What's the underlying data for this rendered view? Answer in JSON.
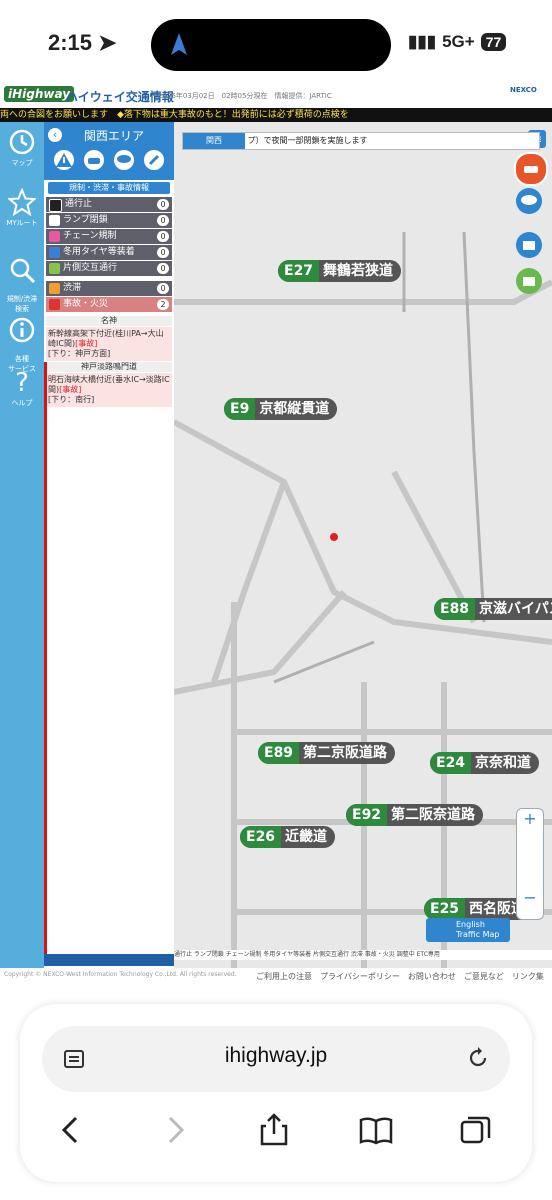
{
  "status_bar": {
    "time": "2:15",
    "network": "5G+",
    "battery": "77"
  },
  "site_header": {
    "logo": "iHighway",
    "title": "ハイウェイ交通情報",
    "update_time": "2026年03月02日　02時05分現在　情報提供：JARTIC",
    "brand": "NEXCO",
    "ticker": "両への合図をお願いします　◆落下物は重大事故のもと！出発前には必ず積荷の点検を"
  },
  "left_rail": [
    {
      "icon": "clock-icon",
      "label": "マップ"
    },
    {
      "icon": "star-icon",
      "label": "MYルート"
    },
    {
      "icon": "search-icon",
      "label": "規制/渋滞\n検索"
    },
    {
      "icon": "info-icon",
      "label": "各種\nサービス"
    },
    {
      "icon": "help-icon",
      "label": "ヘルプ"
    }
  ],
  "panel": {
    "area_title": "関西エリア",
    "subtitle": "規制・渋滞・事故情報",
    "categories": [
      {
        "label": "通行止",
        "count": "0",
        "color": "#222222"
      },
      {
        "label": "ランプ閉鎖",
        "count": "0",
        "color": "#ffffff"
      },
      {
        "label": "チェーン規制",
        "count": "0",
        "color": "#e85aa0"
      },
      {
        "label": "冬用タイヤ等装着",
        "count": "0",
        "color": "#3a7fd5"
      },
      {
        "label": "片側交互通行",
        "count": "0",
        "color": "#8bc34a"
      },
      {
        "label": "渋滞",
        "count": "0",
        "color": "#f0a030"
      },
      {
        "label": "事故・火災",
        "count": "2",
        "color": "#d33"
      }
    ],
    "sections": [
      {
        "name": "名神",
        "incident": "新幹線高架下付近(桂川PA→大山崎IC間)",
        "tag": "[事故]",
        "direction": "[下り：神戸方面]"
      },
      {
        "name": "神戸淡路鳴門道",
        "incident": "明石海峡大橋付近(垂水IC→淡路IC間)",
        "tag": "[事故]",
        "direction": "[下り：南行]"
      }
    ]
  },
  "map": {
    "notice_region": "関西",
    "notice_text": "プ）で夜間一部閉鎖を実施します",
    "routes": [
      {
        "num": "E27",
        "name": "舞鶴若狭道"
      },
      {
        "num": "E9",
        "name": "京都縦貫道"
      },
      {
        "num": "E88",
        "name": "京滋バイパス"
      },
      {
        "num": "E89",
        "name": "第二京阪道路"
      },
      {
        "num": "E24",
        "name": "京奈和道"
      },
      {
        "num": "E92",
        "name": "第二阪奈道路"
      },
      {
        "num": "E26",
        "name": "近畿道"
      },
      {
        "num": "E25",
        "name": "西名阪道"
      }
    ],
    "legend": "通行止 ランプ閉鎖 チェーン規制 冬用タイヤ等装着 片側交互通行 渋滞 事故・火災 調整中 ETC専用",
    "english_map": "English Traffic Map"
  },
  "footer": {
    "copyright": "Copyright © NEXCO-West Information Technology Co.,Ltd. All rights reserved.",
    "links": "ご利用上の注意　プライバシーポリシー　お問い合わせ　ご意見など　リンク集"
  },
  "browser": {
    "url": "ihighway.jp"
  }
}
